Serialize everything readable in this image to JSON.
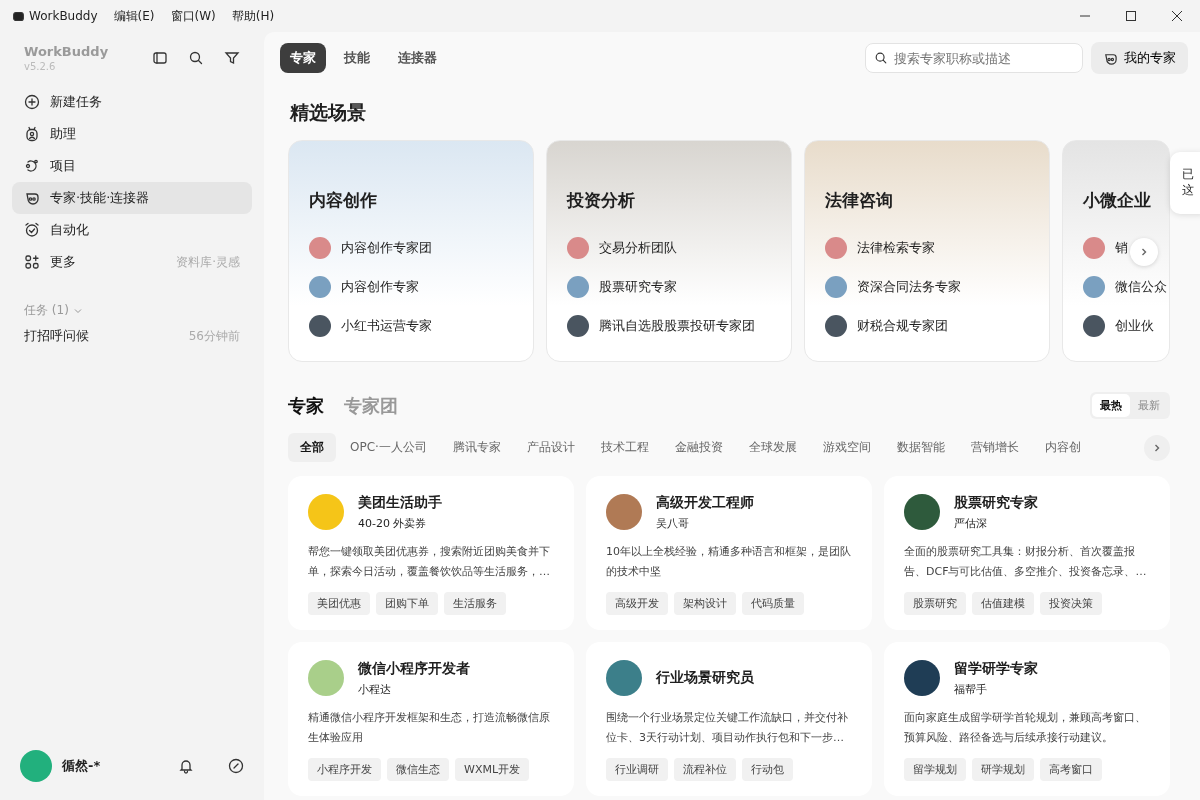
{
  "menu": {
    "app_name": "WorkBuddy",
    "items": [
      "编辑(E)",
      "窗口(W)",
      "帮助(H)"
    ]
  },
  "sidebar": {
    "brand": "WorkBuddy",
    "version": "v5.2.6",
    "nav": [
      {
        "label": "新建任务",
        "selected": false
      },
      {
        "label": "助理",
        "selected": false
      },
      {
        "label": "项目",
        "selected": false
      },
      {
        "label": "专家·技能·连接器",
        "selected": true
      },
      {
        "label": "自动化",
        "selected": false
      },
      {
        "label": "更多",
        "selected": false,
        "hint": "资料库·灵感"
      }
    ],
    "tasks_header": "任务 (1)",
    "tasks": [
      {
        "title": "打招呼问候",
        "time": "56分钟前"
      }
    ],
    "user": "循然-*"
  },
  "top_tabs": [
    {
      "label": "专家",
      "selected": true
    },
    {
      "label": "技能",
      "selected": false
    },
    {
      "label": "连接器",
      "selected": false
    }
  ],
  "search": {
    "placeholder": "搜索专家职称或描述"
  },
  "my_experts": "我的专家",
  "featured_title": "精选场景",
  "scenes": [
    {
      "title": "内容创作",
      "items": [
        "内容创作专家团",
        "内容创作专家",
        "小红书运营专家"
      ]
    },
    {
      "title": "投资分析",
      "items": [
        "交易分析团队",
        "股票研究专家",
        "腾讯自选股股票投研专家团"
      ]
    },
    {
      "title": "法律咨询",
      "items": [
        "法律检索专家",
        "资深合同法务专家",
        "财税合规专家团"
      ]
    },
    {
      "title": "小微企业",
      "items": [
        "销",
        "微信公众",
        "创业伙"
      ]
    }
  ],
  "toast": {
    "lines": [
      "已",
      "这"
    ]
  },
  "section_tabs": [
    {
      "label": "专家",
      "selected": true
    },
    {
      "label": "专家团",
      "selected": false
    }
  ],
  "sort": [
    {
      "label": "最热",
      "selected": true
    },
    {
      "label": "最新",
      "selected": false
    }
  ],
  "categories": [
    {
      "label": "全部",
      "selected": true
    },
    {
      "label": "OPC·一人公司",
      "selected": false
    },
    {
      "label": "腾讯专家",
      "selected": false
    },
    {
      "label": "产品设计",
      "selected": false
    },
    {
      "label": "技术工程",
      "selected": false
    },
    {
      "label": "金融投资",
      "selected": false
    },
    {
      "label": "全球发展",
      "selected": false
    },
    {
      "label": "游戏空间",
      "selected": false
    },
    {
      "label": "数据智能",
      "selected": false
    },
    {
      "label": "营销增长",
      "selected": false
    },
    {
      "label": "内容创",
      "selected": false
    }
  ],
  "experts": [
    {
      "name": "美团生活助手",
      "subtitle": "40-20 外卖券",
      "description": "帮您一键领取美团优惠券，搜索附近团购美食并下单，探索今日活动，覆盖餐饮饮品等生活服务，…",
      "tags": [
        "美团优惠",
        "团购下单",
        "生活服务"
      ],
      "color": "#f5c518"
    },
    {
      "name": "高级开发工程师",
      "subtitle": "吴八哥",
      "description": "10年以上全栈经验，精通多种语言和框架，是团队的技术中坚",
      "tags": [
        "高级开发",
        "架构设计",
        "代码质量"
      ],
      "color": "#b07a55"
    },
    {
      "name": "股票研究专家",
      "subtitle": "严估深",
      "description": "全面的股票研究工具集：财报分析、首次覆盖报告、DCF与可比估值、多空推介、投资备忘录、…",
      "tags": [
        "股票研究",
        "估值建模",
        "投资决策"
      ],
      "color": "#2e5a3c"
    },
    {
      "name": "微信小程序开发者",
      "subtitle": "小程达",
      "description": "精通微信小程序开发框架和生态，打造流畅微信原生体验应用",
      "tags": [
        "小程序开发",
        "微信生态",
        "WXML开发"
      ],
      "color": "#a9cf8a"
    },
    {
      "name": "行业场景研究员",
      "description": "围绕一个行业场景定位关键工作流缺口，并交付补位卡、3天行动计划、项目动作执行包和下一步…",
      "tags": [
        "行业调研",
        "流程补位",
        "行动包"
      ],
      "color": "#3c7f8a"
    },
    {
      "name": "留学研学专家",
      "subtitle": "福帮手",
      "description": "面向家庭生成留学研学首轮规划，兼顾高考窗口、预算风险、路径备选与后续承接行动建议。",
      "tags": [
        "留学规划",
        "研学规划",
        "高考窗口"
      ],
      "color": "#1f3d55"
    }
  ]
}
